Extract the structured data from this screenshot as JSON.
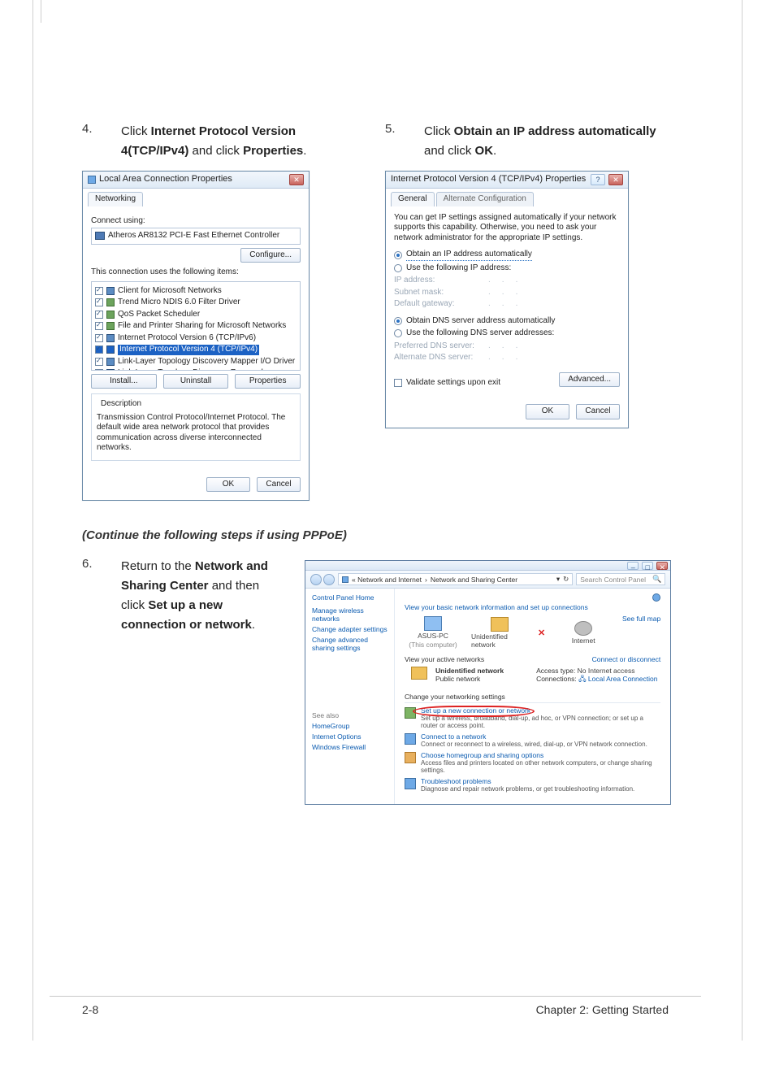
{
  "steps": {
    "s4": {
      "num": "4.",
      "pre": "Click ",
      "b1": "Internet Protocol Version 4(TCP/IPv4)",
      "mid": " and click ",
      "b2": "Properties",
      "post": "."
    },
    "s5": {
      "num": "5.",
      "pre": "Click ",
      "b1": "Obtain an IP address automatically",
      "mid": " and click ",
      "b2": "OK",
      "post": "."
    },
    "s6": {
      "num": "6.",
      "pre": "Return to the ",
      "b1": "Network and Sharing Center",
      "mid": " and then click ",
      "b2": "Set up a new connection or network",
      "post": "."
    }
  },
  "continue_heading": "(Continue the following steps if using PPPoE)",
  "lac": {
    "title": "Local Area Connection Properties",
    "tab": "Networking",
    "connect_using": "Connect using:",
    "adapter": "Atheros AR8132 PCI-E Fast Ethernet Controller",
    "configure": "Configure...",
    "uses": "This connection uses the following items:",
    "items": [
      "Client for Microsoft Networks",
      "Trend Micro NDIS 6.0 Filter Driver",
      "QoS Packet Scheduler",
      "File and Printer Sharing for Microsoft Networks",
      "Internet Protocol Version 6 (TCP/IPv6)",
      "Internet Protocol Version 4 (TCP/IPv4)",
      "Link-Layer Topology Discovery Mapper I/O Driver",
      "Link-Layer Topology Discovery Responder"
    ],
    "install": "Install...",
    "uninstall": "Uninstall",
    "properties": "Properties",
    "desc_legend": "Description",
    "desc": "Transmission Control Protocol/Internet Protocol. The default wide area network protocol that provides communication across diverse interconnected networks.",
    "ok": "OK",
    "cancel": "Cancel"
  },
  "ipv4": {
    "title": "Internet Protocol Version 4 (TCP/IPv4) Properties",
    "tab_general": "General",
    "tab_alt": "Alternate Configuration",
    "blurb": "You can get IP settings assigned automatically if your network supports this capability. Otherwise, you need to ask your network administrator for the appropriate IP settings.",
    "r_auto_ip": "Obtain an IP address automatically",
    "r_use_ip": "Use the following IP address:",
    "ip_addr": "IP address:",
    "subnet": "Subnet mask:",
    "gateway": "Default gateway:",
    "r_auto_dns": "Obtain DNS server address automatically",
    "r_use_dns": "Use the following DNS server addresses:",
    "pref_dns": "Preferred DNS server:",
    "alt_dns": "Alternate DNS server:",
    "validate": "Validate settings upon exit",
    "advanced": "Advanced...",
    "ok": "OK",
    "cancel": "Cancel"
  },
  "nsc": {
    "crumb1": "« Network and Internet",
    "crumb2": "Network and Sharing Center",
    "search": "Search Control Panel",
    "left_home": "Control Panel Home",
    "left_links": [
      "Manage wireless networks",
      "Change adapter settings",
      "Change advanced sharing settings"
    ],
    "left_see_also": "See also",
    "left_see_items": [
      "HomeGroup",
      "Internet Options",
      "Windows Firewall"
    ],
    "hdr": "View your basic network information and set up connections",
    "see_full_map": "See full map",
    "node_pc": "ASUS-PC",
    "node_pc_sub": "(This computer)",
    "node_unid": "Unidentified network",
    "node_net": "Internet",
    "view_active": "View your active networks",
    "connect_disc": "Connect or disconnect",
    "net_name": "Unidentified network",
    "net_kind": "Public network",
    "access_type_l": "Access type:",
    "access_type_v": "No Internet access",
    "conn_l": "Connections:",
    "conn_v": "Local Area Connection",
    "change_net": "Change your networking settings",
    "tasks": [
      {
        "title": "Set up a new connection or network",
        "sub": "Set up a wireless, broadband, dial-up, ad hoc, or VPN connection; or set up a router or access point."
      },
      {
        "title": "Connect to a network",
        "sub": "Connect or reconnect to a wireless, wired, dial-up, or VPN network connection."
      },
      {
        "title": "Choose homegroup and sharing options",
        "sub": "Access files and printers located on other network computers, or change sharing settings."
      },
      {
        "title": "Troubleshoot problems",
        "sub": "Diagnose and repair network problems, or get troubleshooting information."
      }
    ]
  },
  "footer": {
    "left": "2-8",
    "right": "Chapter 2: Getting Started"
  }
}
